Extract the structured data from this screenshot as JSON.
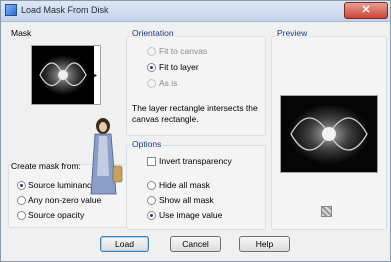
{
  "window": {
    "title": "Load Mask From Disk",
    "close_symbol": "✕"
  },
  "mask": {
    "label": "Mask"
  },
  "orientation": {
    "label": "Orientation",
    "options": [
      "Fit to canvas",
      "Fit to layer",
      "As is"
    ],
    "selected": "Fit to layer",
    "description": "The layer rectangle intersects the canvas rectangle."
  },
  "preview": {
    "label": "Preview"
  },
  "create_mask": {
    "label": "Create mask from:",
    "options": [
      "Source luminance",
      "Any non-zero value",
      "Source opacity"
    ],
    "selected": "Source luminance"
  },
  "options": {
    "label": "Options",
    "invert_label": "Invert transparency",
    "invert_checked": false,
    "radios": [
      "Hide all mask",
      "Show all mask",
      "Use image value"
    ],
    "selected": "Use image value"
  },
  "buttons": {
    "load": "Load",
    "cancel": "Cancel",
    "help": "Help"
  },
  "colors": {
    "accent": "#1d3b8a",
    "title_bar": "#c3d3ea",
    "close": "#c8463a"
  }
}
